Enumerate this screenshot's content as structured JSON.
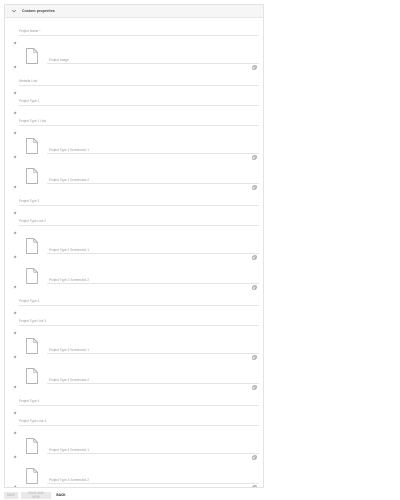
{
  "panel": {
    "title": "Custom properties",
    "collapse_icon": "chevron-down-icon"
  },
  "fields": [
    {
      "type": "text",
      "label": "Project Name *"
    },
    {
      "type": "image",
      "label": "Project Image"
    },
    {
      "type": "text",
      "label": "Website Link"
    },
    {
      "type": "text",
      "label": "Project Type 1"
    },
    {
      "type": "text",
      "label": "Project Type 1 Link"
    },
    {
      "type": "image",
      "label": "Project Type 1 Screenshot 1"
    },
    {
      "type": "image",
      "label": "Project Type 1 Screenshot 2"
    },
    {
      "type": "text",
      "label": "Project Type 2"
    },
    {
      "type": "text",
      "label": "Project Type Link 2"
    },
    {
      "type": "image",
      "label": "Project Type 2 Screenshot 1"
    },
    {
      "type": "image",
      "label": "Project Type 2 Screenshot 2"
    },
    {
      "type": "text",
      "label": "Project Type 3"
    },
    {
      "type": "text",
      "label": "Project Type Link 3"
    },
    {
      "type": "image",
      "label": "Project Type 3 Screenshot 1"
    },
    {
      "type": "image",
      "label": "Project Type 3 Screenshot 2"
    },
    {
      "type": "text",
      "label": "Project Type 4"
    },
    {
      "type": "text",
      "label": "Project Type Link 4"
    },
    {
      "type": "image",
      "label": "Project Type 4 Screenshot 1"
    },
    {
      "type": "image",
      "label": "Project Type 4 Screenshot 2"
    }
  ],
  "footer": {
    "save": "SAVE",
    "save_and_new": "SAVE AND NEW",
    "back": "BACK"
  }
}
